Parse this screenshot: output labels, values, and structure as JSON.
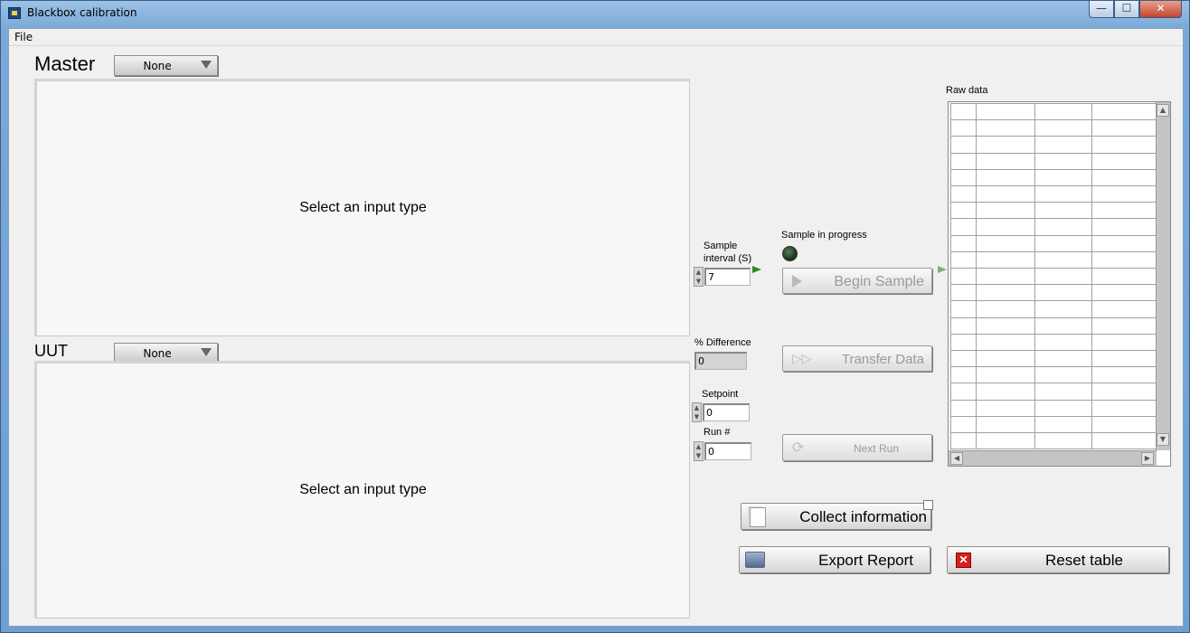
{
  "window": {
    "title": "Blackbox calibration",
    "min_glyph": "—",
    "max_glyph": "☐",
    "close_glyph": "✕"
  },
  "menu": {
    "file": "File"
  },
  "master": {
    "label": "Master",
    "selected": "None",
    "placeholder": "Select an input type"
  },
  "uut": {
    "label": "UUT",
    "selected": "None",
    "placeholder": "Select an input type"
  },
  "controls": {
    "sample_interval_label": "Sample interval (S)",
    "sample_interval_value": "7",
    "percent_difference_label": "% Difference",
    "percent_difference_value": "0",
    "setpoint_label": "Setpoint",
    "setpoint_value": "0",
    "run_label": "Run #",
    "run_value": "0",
    "sample_in_progress_label": "Sample in progress"
  },
  "buttons": {
    "begin_sample": "Begin Sample",
    "transfer_data": "Transfer Data",
    "next_run": "Next Run",
    "collect_information": "Collect information",
    "export_report": "Export Report",
    "reset_table": "Reset table"
  },
  "table": {
    "label": "Raw data",
    "columns": 4,
    "rows": 21
  }
}
